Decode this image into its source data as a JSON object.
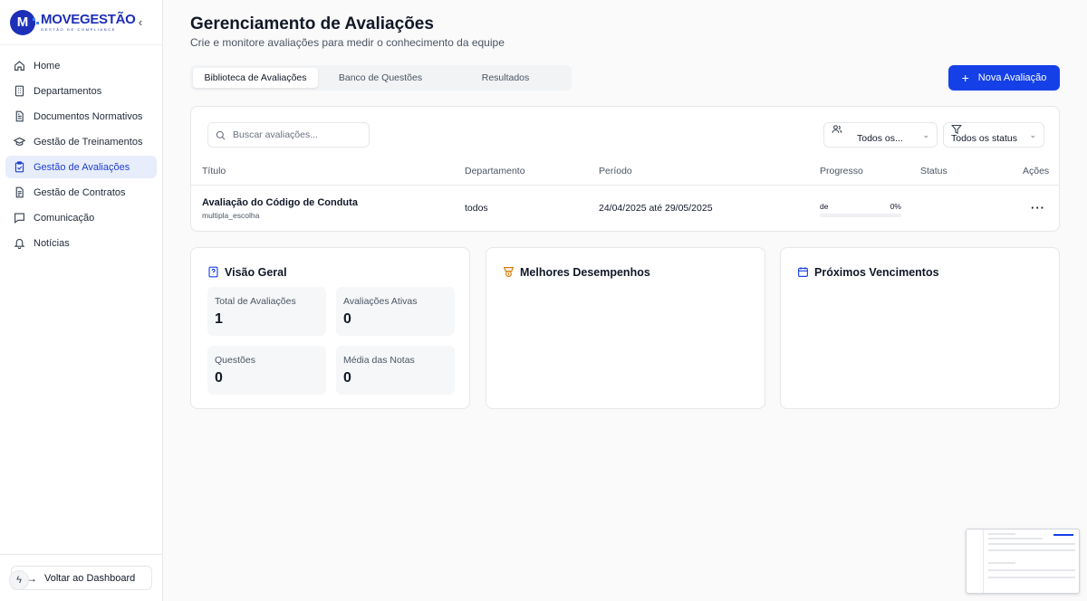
{
  "brand": {
    "name": "MOVEGESTÃO",
    "tagline": "GESTÃO DE COMPLIANCE",
    "logo_letter": "M"
  },
  "sidebar": {
    "items": [
      {
        "label": "Home",
        "icon": "home-icon",
        "active": false
      },
      {
        "label": "Departamentos",
        "icon": "building-icon",
        "active": false
      },
      {
        "label": "Documentos Normativos",
        "icon": "file-text-icon",
        "active": false
      },
      {
        "label": "Gestão de Treinamentos",
        "icon": "graduation-cap-icon",
        "active": false
      },
      {
        "label": "Gestão de Avaliações",
        "icon": "clipboard-check-icon",
        "active": true
      },
      {
        "label": "Gestão de Contratos",
        "icon": "file-contract-icon",
        "active": false
      },
      {
        "label": "Comunicação",
        "icon": "message-square-icon",
        "active": false
      },
      {
        "label": "Notícias",
        "icon": "bell-icon",
        "active": false
      }
    ],
    "back_label": "Voltar ao Dashboard"
  },
  "header": {
    "title": "Gerenciamento de Avaliações",
    "subtitle": "Crie e monitore avaliações para medir o conhecimento da equipe"
  },
  "tabs": [
    {
      "label": "Biblioteca de Avaliações",
      "active": true
    },
    {
      "label": "Banco de Questões",
      "active": false
    },
    {
      "label": "Resultados",
      "active": false
    }
  ],
  "new_button_label": "Nova Avaliação",
  "search": {
    "placeholder": "Buscar avaliações...",
    "value": ""
  },
  "filters": {
    "department": "Todos os...",
    "status": "Todos os status"
  },
  "table": {
    "columns": [
      "Título",
      "Departamento",
      "Período",
      "Progresso",
      "Status",
      "Ações"
    ],
    "rows": [
      {
        "title": "Avaliação do Código de Conduta",
        "type": "multipla_escolha",
        "department": "todos",
        "period": "24/04/2025 até 29/05/2025",
        "progress_label": "de",
        "progress_percent": "0%",
        "progress_value": 0,
        "status": "",
        "actions": "···"
      }
    ]
  },
  "overview": {
    "title": "Visão Geral",
    "stats": [
      {
        "label": "Total de Avaliações",
        "value": "1"
      },
      {
        "label": "Avaliações Ativas",
        "value": "0"
      },
      {
        "label": "Questões",
        "value": "0"
      },
      {
        "label": "Média das Notas",
        "value": "0"
      }
    ]
  },
  "top_performers": {
    "title": "Melhores Desempenhos"
  },
  "upcoming": {
    "title": "Próximos Vencimentos"
  },
  "colors": {
    "primary": "#1540e8",
    "brand": "#1d2fb8",
    "active_nav_bg": "#e8edfb"
  }
}
